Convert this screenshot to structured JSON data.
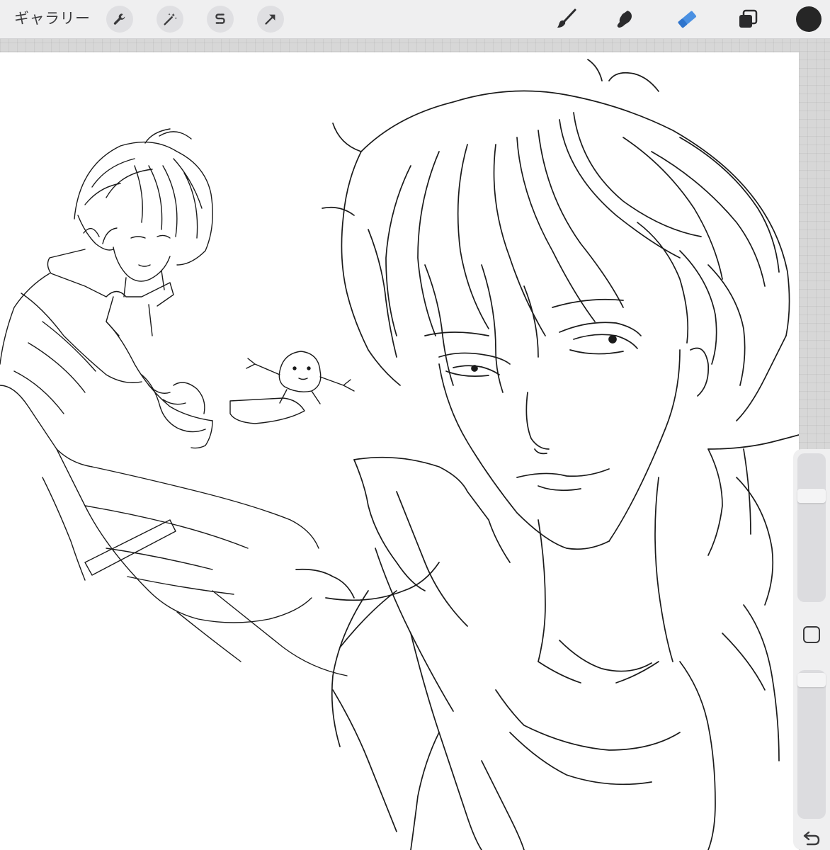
{
  "toolbar": {
    "gallery_label": "ギャラリー",
    "left_tools": [
      {
        "icon": "wrench-icon",
        "name": "actions"
      },
      {
        "icon": "magic-wand-icon",
        "name": "adjustments"
      },
      {
        "icon": "selection-s-icon",
        "name": "selection"
      },
      {
        "icon": "arrow-cursor-icon",
        "name": "transform"
      }
    ],
    "right_tools": [
      {
        "icon": "brush-icon",
        "name": "paint",
        "active": false
      },
      {
        "icon": "smudge-icon",
        "name": "smudge",
        "active": false
      },
      {
        "icon": "eraser-icon",
        "name": "erase",
        "active": true
      },
      {
        "icon": "layers-icon",
        "name": "layers",
        "active": false
      }
    ],
    "current_color": "#262626",
    "active_color": "#4a90e2"
  },
  "side_panel": {
    "brush_size_level": 0.1,
    "opacity_level": 0.0,
    "modify_icon": "square-icon",
    "undo_icon": "undo-arrow-icon"
  }
}
